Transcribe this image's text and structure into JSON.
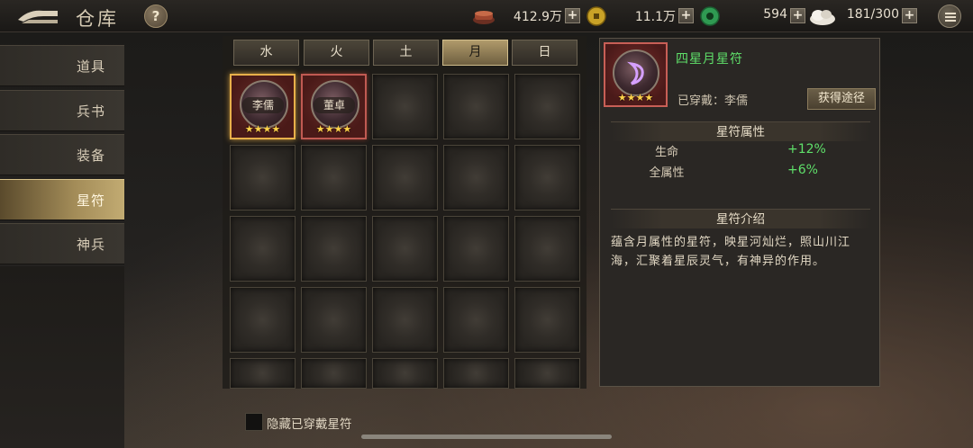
{
  "header": {
    "title": "仓库",
    "help_label": "?",
    "resources": [
      {
        "name": "copper",
        "icon": "copper-ingot-icon",
        "value": "412.9万"
      },
      {
        "name": "gold-coin",
        "icon": "gold-coin-icon",
        "value": "11.1万"
      },
      {
        "name": "jade",
        "icon": "jade-icon",
        "value": "594"
      },
      {
        "name": "food",
        "icon": "rice-bag-icon",
        "value": "181/300"
      }
    ],
    "plus_label": "+"
  },
  "sidebar": {
    "items": [
      {
        "label": "道具",
        "active": false
      },
      {
        "label": "兵书",
        "active": false
      },
      {
        "label": "装备",
        "active": false
      },
      {
        "label": "星符",
        "active": true
      },
      {
        "label": "神兵",
        "active": false
      }
    ]
  },
  "inventory": {
    "tabs": [
      {
        "label": "水",
        "active": false
      },
      {
        "label": "火",
        "active": false
      },
      {
        "label": "土",
        "active": false
      },
      {
        "label": "月",
        "active": true
      },
      {
        "label": "日",
        "active": false
      }
    ],
    "items": [
      {
        "name": "李儒",
        "stars": "★★★★",
        "selected": true
      },
      {
        "name": "董卓",
        "stars": "★★★★",
        "selected": false
      }
    ],
    "hide_equipped_label": "隐藏已穿戴星符",
    "hide_equipped_checked": false
  },
  "detail": {
    "name": "四星月星符",
    "stars": "★★★★",
    "equipped_text": "已穿戴：李儒",
    "source_button": "获得途径",
    "attributes_title": "星符属性",
    "attributes": [
      {
        "name": "生命",
        "value": "+12%"
      },
      {
        "name": "全属性",
        "value": "+6%"
      }
    ],
    "intro_title": "星符介绍",
    "intro_text": "蕴含月属性的星符，映星河灿烂，照山川江海，汇聚着星辰灵气，有神异的作用。"
  },
  "colors": {
    "accent_gold": "#c2ab72",
    "attribute_green": "#5fe06a",
    "slot_red_border": "#c05a52",
    "star_yellow": "#ffd24a"
  }
}
